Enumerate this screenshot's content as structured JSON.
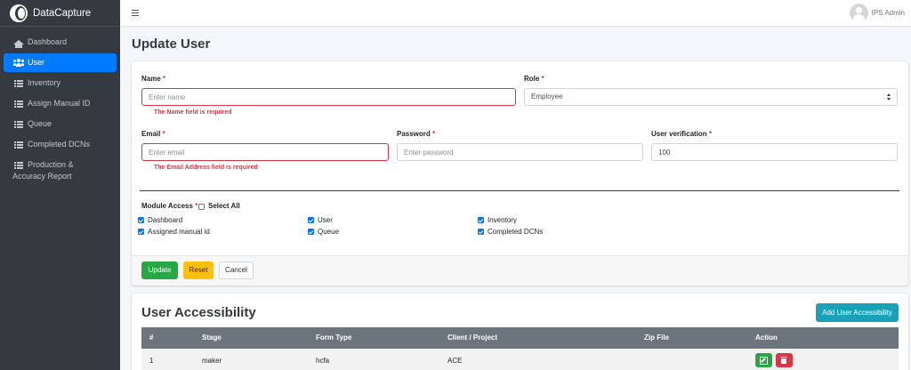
{
  "brand": {
    "name": "DataCapture"
  },
  "sidebar": {
    "items": [
      {
        "label": "Dashboard",
        "icon": "home-icon"
      },
      {
        "label": "User",
        "icon": "users-icon",
        "active": true
      },
      {
        "label": "Inventory",
        "icon": "list-icon"
      },
      {
        "label": "Assign Manual ID",
        "icon": "list-icon"
      },
      {
        "label": "Queue",
        "icon": "list-icon"
      },
      {
        "label": "Completed DCNs",
        "icon": "list-icon"
      },
      {
        "label": "Production & Accuracy Report",
        "icon": "list-icon"
      }
    ]
  },
  "topbar": {
    "user_name": "IPS Admin"
  },
  "page": {
    "title": "Update User"
  },
  "form": {
    "name": {
      "label": "Name",
      "required_mark": "*",
      "placeholder": "Enter name",
      "value": "",
      "error": "The Name field is required"
    },
    "role": {
      "label": "Role",
      "required_mark": "*",
      "selected": "Employee"
    },
    "email": {
      "label": "Email",
      "required_mark": "*",
      "placeholder": "Enter email",
      "value": "",
      "error": "The Email Address field is required"
    },
    "password": {
      "label": "Password",
      "required_mark": "*",
      "placeholder": "Enter password",
      "value": ""
    },
    "verification": {
      "label": "User verification",
      "required_mark": "*",
      "value": "100"
    },
    "module_access": {
      "label": "Module Access",
      "required_mark": "*",
      "select_all_label": "Select All",
      "select_all_checked": false,
      "modules": [
        {
          "label": "Dashboard",
          "checked": true
        },
        {
          "label": "User",
          "checked": true
        },
        {
          "label": "Inventory",
          "checked": true
        },
        {
          "label": "Assigned manual id",
          "checked": true
        },
        {
          "label": "Queue",
          "checked": true
        },
        {
          "label": "Completed DCNs",
          "checked": true
        }
      ]
    },
    "buttons": {
      "update": "Update",
      "reset": "Reset",
      "cancel": "Cancel"
    }
  },
  "accessibility": {
    "title": "User Accessibility",
    "add_button": "Add User Accessibility",
    "columns": [
      "#",
      "Stage",
      "Form Type",
      "Client / Project",
      "Zip File",
      "Action"
    ],
    "rows": [
      {
        "num": "1",
        "stage": "maker",
        "form_type": "hcfa",
        "client_project": "ACE",
        "zip_file": ""
      }
    ]
  },
  "colors": {
    "primary": "#007bff",
    "sidebar_bg": "#343a40",
    "success": "#28a745",
    "warning": "#ffc107",
    "danger": "#dc3545",
    "info": "#17a2b8"
  }
}
